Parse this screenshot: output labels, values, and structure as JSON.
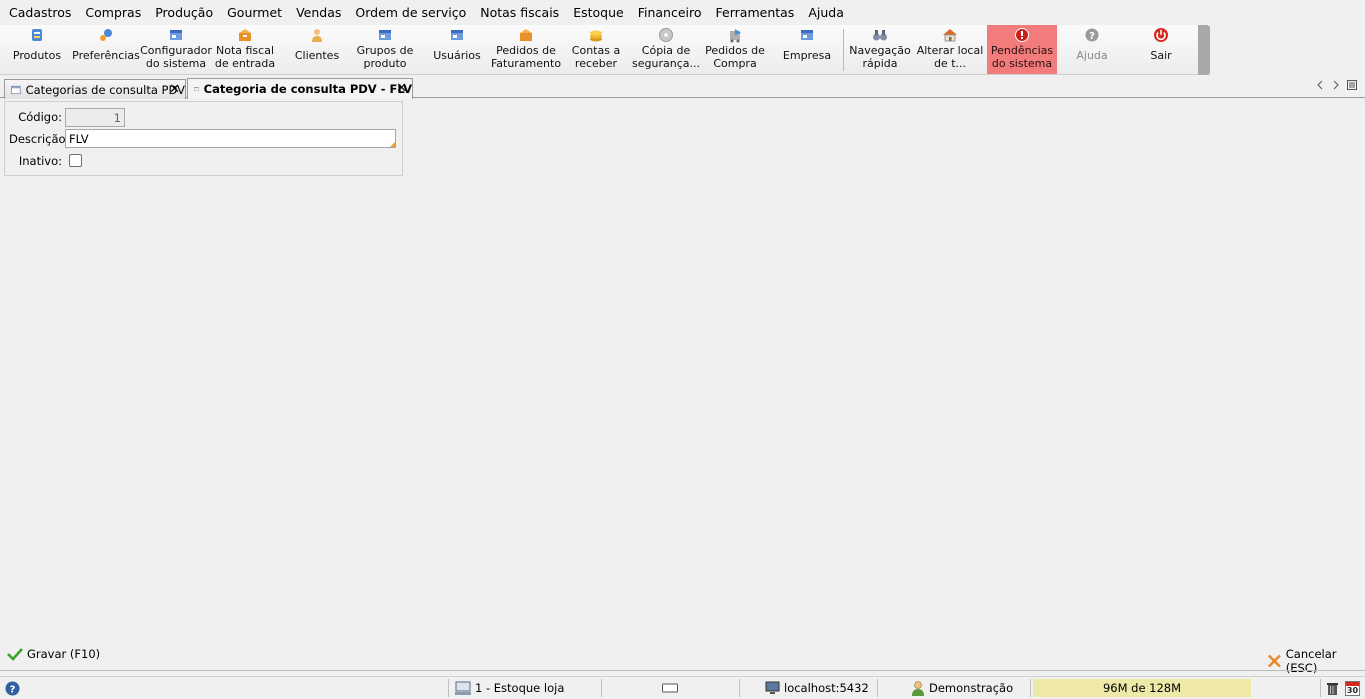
{
  "menu": [
    "Cadastros",
    "Compras",
    "Produção",
    "Gourmet",
    "Vendas",
    "Ordem de serviço",
    "Notas fiscais",
    "Estoque",
    "Financeiro",
    "Ferramentas",
    "Ajuda"
  ],
  "toolbar": {
    "produtos": "Produtos",
    "preferencias": "Preferências",
    "configurador": "Configurador\ndo sistema",
    "nota_fiscal": "Nota fiscal\nde entrada",
    "clientes": "Clientes",
    "grupos": "Grupos de\nproduto",
    "usuarios": "Usuários",
    "pedidos_fat": "Pedidos de\nFaturamento",
    "contas": "Contas a\nreceber",
    "copia": "Cópia de\nsegurança...",
    "pedidos_compra": "Pedidos de\nCompra",
    "empresa": "Empresa",
    "navegacao": "Navegação\nrápida",
    "alterar": "Alterar local\nde t...",
    "pendencias": "Pendências\ndo sistema",
    "ajuda": "Ajuda",
    "sair": "Sair"
  },
  "tabs": {
    "tab1": "Categorias de consulta PDV",
    "tab2": "Categoria de consulta PDV - FLV",
    "close": "✕"
  },
  "form": {
    "codigo_label": "Código:",
    "codigo_value": "1",
    "descricao_label": "Descrição:",
    "descricao_value": "FLV",
    "inativo_label": "Inativo:",
    "inativo_checked": false
  },
  "actions": {
    "gravar": "Gravar (F10)",
    "cancelar": "Cancelar (ESC)"
  },
  "status": {
    "estoque": "1 - Estoque loja",
    "server": "localhost:5432",
    "user": "Demonstração",
    "memory": "96M de 128M",
    "calendar_day": "30"
  },
  "colors": {
    "alert_bg": "#f27b7b",
    "memory_bg": "#efe9a8",
    "accept_green": "#3aa12a",
    "cancel_orange": "#e8882a"
  }
}
